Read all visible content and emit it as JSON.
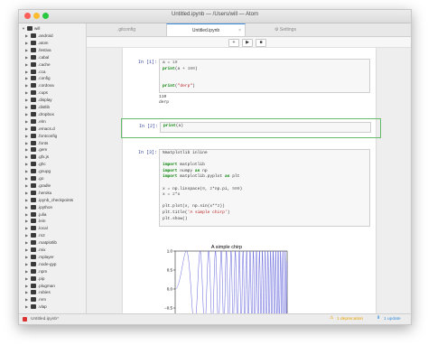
{
  "window": {
    "title": "Untitled.ipynb — /Users/will — Atom"
  },
  "sidebar": {
    "root": "will",
    "items": [
      ".android",
      ".atom",
      ".festiva",
      ".cabal",
      ".cache",
      ".cca",
      ".config",
      ".cordova",
      ".cups",
      ".display",
      ".distlib",
      ".dropbox",
      ".elm",
      ".emacs.d",
      ".fontconfig",
      ".fonts",
      ".gem",
      ".gfx.js",
      ".ghc",
      ".gnupg",
      ".go",
      ".gradle",
      ".heroku",
      ".ipynb_checkpoints",
      ".ipython",
      ".julia",
      ".lein",
      ".local",
      ".m2",
      ".matplotlib",
      ".mix",
      ".mplayer",
      ".node-gyp",
      ".npm",
      ".pip",
      ".plugman",
      ".rubies",
      ".rvm",
      ".vlap"
    ]
  },
  "tabs": [
    {
      "label": ".gitconfig"
    },
    {
      "label": "Untitled.ipynb"
    },
    {
      "label": "Settings"
    }
  ],
  "toolbar": {
    "add_label": "+",
    "run_label": "▶",
    "stop_label": "■"
  },
  "cells": [
    {
      "prompt": "In [1]:",
      "lines": [
        "a = 10",
        "print(a + 100)",
        "",
        "",
        "print(\"derp\")"
      ],
      "output": [
        "110",
        "derp"
      ]
    },
    {
      "prompt": "In [2]:",
      "lines": [
        "print(a)"
      ]
    },
    {
      "prompt": "In [3]:",
      "lines": [
        "%matplotlib inline",
        "",
        "import matplotlib",
        "import numpy as np",
        "import matplotlib.pyplot as plt",
        "",
        "x = np.linspace(0, 2*np.pi, 500)",
        "x = 2*x",
        "",
        "plt.plot(x, np.sin(x**2))",
        "plt.title('A simple chirp')",
        "plt.show()"
      ]
    }
  ],
  "chart_data": {
    "type": "line",
    "title": "A simple chirp",
    "xlabel": "",
    "ylabel": "",
    "xlim": [
      0,
      12.566
    ],
    "ylim": [
      -1.0,
      1.0
    ],
    "x_ticks": [
      "0",
      "2",
      "4",
      "6",
      "8",
      "10",
      "12"
    ],
    "y_ticks": [
      "1.0",
      "0.5",
      "0.0",
      "−0.5",
      "−1.0"
    ],
    "function": "sin(x^2)",
    "series": [
      {
        "color": "#4b4bd6"
      }
    ]
  },
  "statusbar": {
    "file": "Untitled.ipynb*",
    "deprecation": "1 deprecation",
    "update": "1 update"
  }
}
